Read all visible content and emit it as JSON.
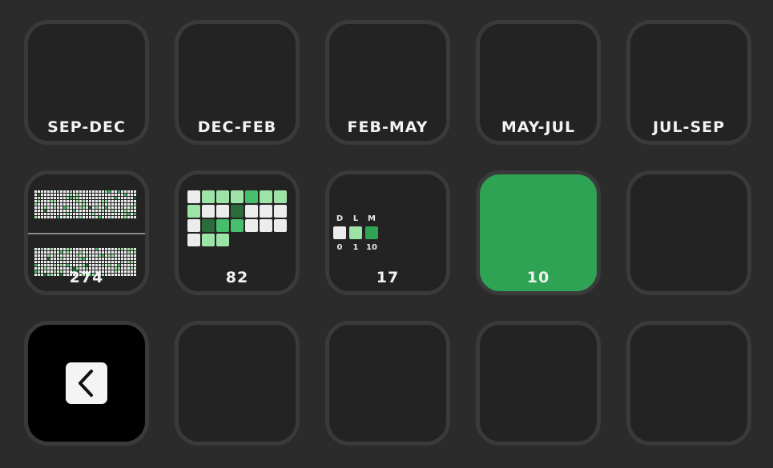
{
  "colors": {
    "empty": "#ececec",
    "level1": "#9ee3a6",
    "level2": "#46be6c",
    "level3": "#2c6b3c",
    "key_bg": "#232323",
    "key_border": "#3a3a3a",
    "accent": "#2fa354"
  },
  "keys": {
    "k1": {
      "label": "SEP-DEC"
    },
    "k2": {
      "label": "DEC-FEB"
    },
    "k3": {
      "label": "FEB-MAY"
    },
    "k4": {
      "label": "MAY-JUL"
    },
    "k5": {
      "label": "JUL-SEP"
    },
    "k6": {
      "label": "274"
    },
    "k7": {
      "label": "82"
    },
    "k8": {
      "label": "17",
      "legend_headers": [
        "D",
        "L",
        "M"
      ],
      "legend_values": [
        "0",
        "1",
        "10"
      ]
    },
    "k9": {
      "label": "10"
    },
    "k11": {
      "icon": "chevron-left-icon"
    }
  },
  "heatmaps": {
    "k1": [
      "1000000000",
      "0000100120",
      "0000000001",
      "1000010001",
      "0000001000",
      "2000010210",
      "0110000201",
      "0100000000",
      "0101100101",
      "0110000010",
      "0000000000",
      "0120000001",
      "0000000001",
      "1000002003"
    ],
    "k2": [
      "1100000000",
      "0000000000",
      "0000000000",
      "1000000000",
      "0000000000",
      "0000000100",
      "0000000000",
      "0100100110",
      "0000000010",
      "0000000100",
      "0100010000",
      "1100000110",
      "1002000012",
      "1100303000"
    ],
    "k3": [
      "0100000000",
      "1000000000",
      "0010001010",
      "1000000000",
      "0000000100",
      "0000000011",
      "0100000000",
      "0001001011",
      "0000000000",
      "0002000001",
      "0000100000",
      "0000100000",
      "0000000000",
      "1000000000"
    ],
    "k4": [
      "0000000000",
      "1000000000",
      "1000000000",
      "0000000000",
      "1000000000",
      "1000000000",
      "0000000000",
      "0010000000",
      "0000000000",
      "0000001000",
      "0000000000",
      "0000000000",
      "0000000000",
      "1000000000"
    ],
    "k5": [
      "0200000000",
      "1101100000",
      "0101000000",
      "0101101000",
      "0200000000",
      "0100001000",
      "0001101000",
      "0003100000",
      "0000002000",
      "0001011000"
    ],
    "k7": [
      "0111211",
      "1003000",
      "0322000",
      "0110000"
    ]
  }
}
